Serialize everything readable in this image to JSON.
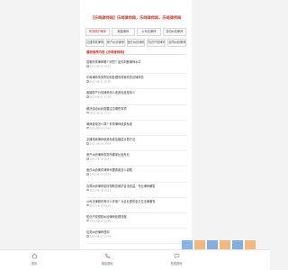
{
  "site": {
    "title": "【乐鸣律师网】乐鸣律师网，乐鸣律师网，乐鸣律师网"
  },
  "tabs": [
    {
      "label": "刑事辩护律师",
      "active": true
    },
    {
      "label": "离婚律师"
    },
    {
      "label": "公司法律师"
    },
    {
      "label": "劳动纠纷律师"
    },
    {
      "label": "交通事故律师"
    },
    {
      "label": "房产纠纷律师"
    },
    {
      "label": "医疗纠纷律师"
    },
    {
      "label": "知识产权律师"
    },
    {
      "label": "合同纠纷律师"
    }
  ],
  "section": {
    "title": "最新推荐内容【乐鸣律师网】"
  },
  "items": [
    {
      "title": "昆明刑事律师哪个好的？如何判断律师水平",
      "date": "2021-06-22 10:52"
    },
    {
      "title": "乐鸣律师事务所如何处理刑事案件的法律事务",
      "date": "2021-06-21 16:30"
    },
    {
      "title": "离婚财产分割律师怎么收费标准是多少",
      "date": "2021-06-21 15:18"
    },
    {
      "title": "解决劳动纠纷需要注意哪些事项",
      "date": "2021-06-21 11:02"
    },
    {
      "title": "律师费用怎么算？刑事律师收费标准",
      "date": "2021-06-20 17:45"
    },
    {
      "title": "交通事故律师收费标准及赔偿计算方法",
      "date": "2021-06-20 14:09"
    },
    {
      "title": "房产纠纷律师事务所哪家比较专业",
      "date": "2021-06-19 16:27"
    },
    {
      "title": "医疗纠纷案件律师代理费用怎么收取",
      "date": "2021-06-19 10:33"
    },
    {
      "title": "合同纠纷律师如何帮助您维护合法权益，专业律师解答",
      "date": "2021-06-18 15:51"
    },
    {
      "title": "公司法律顾问有什么作用？为企业提供全方位法律服务",
      "date": "2021-06-18 09:14"
    },
    {
      "title": "知识产权侵权纠纷律师处理流程",
      "date": "2021-06-17 16:40"
    },
    {
      "title": "债务纠纷律师咨询",
      "date": "2021-06-17 11:06"
    }
  ],
  "bottom_nav": [
    {
      "label": "首页",
      "icon": "home-icon"
    },
    {
      "label": "电话咨询",
      "icon": "phone-icon"
    },
    {
      "label": "在线咨询",
      "icon": "chat-icon"
    }
  ],
  "colors": {
    "accent": "#c23b2a",
    "watermark_orange": "#f08a24",
    "watermark_blue": "#2b77c9"
  }
}
